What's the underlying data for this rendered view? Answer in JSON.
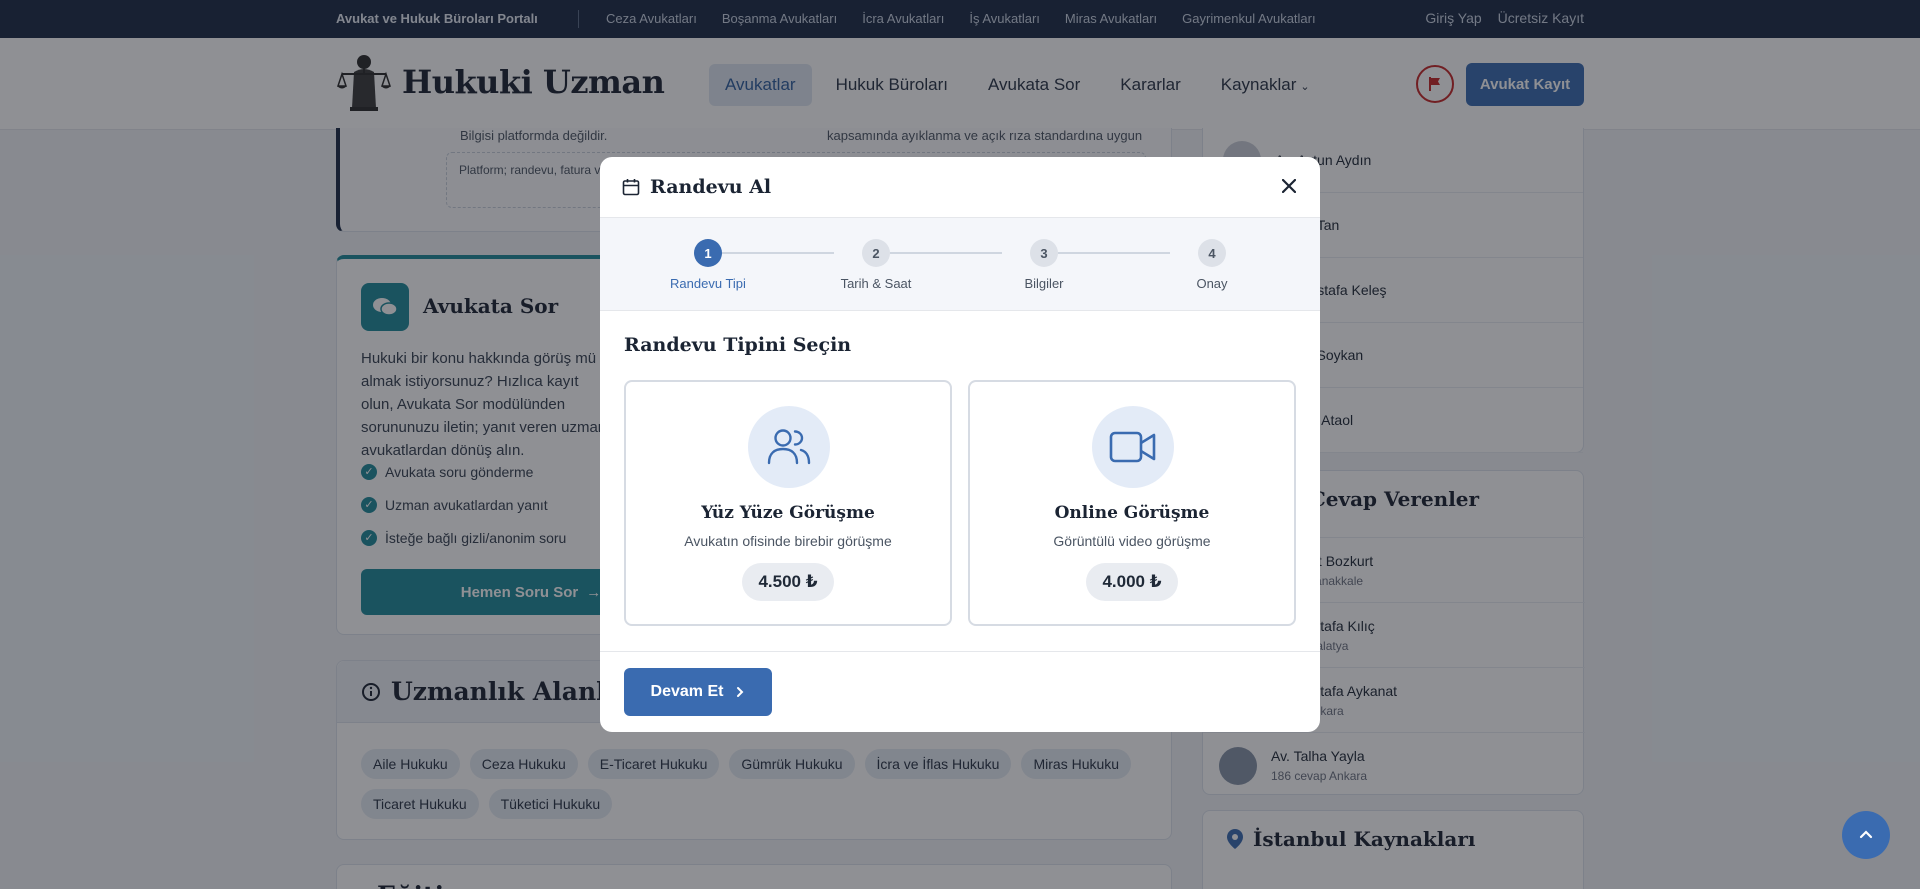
{
  "topbar": {
    "brand": "Avukat ve Hukuk Büroları Portalı",
    "links": [
      "Ceza Avukatları",
      "Boşanma Avukatları",
      "İcra Avukatları",
      "İş Avukatları",
      "Miras Avukatları",
      "Gayrimenkul Avukatları"
    ],
    "login": "Giriş Yap",
    "register": "Ücretsiz Kayıt"
  },
  "header": {
    "logo_text": "Hukuki Uzman",
    "nav": [
      "Avukatlar",
      "Hukuk Büroları",
      "Avukata Sor",
      "Kararlar",
      "Kaynaklar"
    ],
    "register_button": "Avukat Kayıt"
  },
  "infobox": {
    "line_left": "Bilgisi platformda değildir.",
    "line_right": "kapsamında ayıklanma ve açık rıza standardına uygun",
    "note": "Platform; randevu, fatura ve ödeme bilgilerinin sorumluluğunu üstlenmez. Bu kayıtlara dahil değildir. Detaylar"
  },
  "ask": {
    "title": "Avukata Sor",
    "desc": "Hukuki bir konu hakkında görüş mü almak istiyorsunuz? Hızlıca kayıt olun, Avukata Sor modülünden sorununuzu iletin; yanıt veren uzman avukatlardan dönüş alın.",
    "features": [
      "Avukata soru gönderme",
      "Uzman avukatlardan yanıt",
      "İsteğe bağlı gizli/anonim soru"
    ],
    "cta": "Hemen Soru Sor"
  },
  "specialties": {
    "title": "Uzmanlık Alanları",
    "tags": [
      "Aile Hukuku",
      "Ceza Hukuku",
      "E-Ticaret Hukuku",
      "Gümrük Hukuku",
      "İcra ve İflas Hukuku",
      "Miras Hukuku",
      "Ticaret Hukuku",
      "Tüketici Hukuku"
    ]
  },
  "next_section": {
    "title": "Eğitim"
  },
  "side_lawyers": [
    "Av. Aytun Aydın",
    "Av. Ay Tan",
    "Av. Mustafa Keleş",
    "Av. Ali Soykan",
    "Av. Ata Ataol"
  ],
  "top_answerers": {
    "title": "En Çok Cevap Verenler",
    "items": [
      {
        "name": "Av. Mert Bozkurt",
        "meta": "cevap  Çanakkale"
      },
      {
        "name": "Av. Mustafa Kılıç",
        "meta": "cevap  Malatya"
      },
      {
        "name": "Av. Mustafa Aykanat",
        "meta": "cevap  Ankara"
      },
      {
        "name": "Av. Talha Yayla",
        "meta": "186 cevap  Ankara"
      }
    ]
  },
  "istanbul": {
    "title": "İstanbul Kaynakları"
  },
  "modal": {
    "title": "Randevu Al",
    "steps": [
      {
        "num": "1",
        "label": "Randevu Tipi"
      },
      {
        "num": "2",
        "label": "Tarih & Saat"
      },
      {
        "num": "3",
        "label": "Bilgiler"
      },
      {
        "num": "4",
        "label": "Onay"
      }
    ],
    "section_title": "Randevu Tipini Seçin",
    "options": [
      {
        "title": "Yüz Yüze Görüşme",
        "desc": "Avukatın ofisinde birebir görüşme",
        "price": "4.500 ₺"
      },
      {
        "title": "Online Görüşme",
        "desc": "Görüntülü video görüşme",
        "price": "4.000 ₺"
      }
    ],
    "continue": "Devam Et"
  }
}
